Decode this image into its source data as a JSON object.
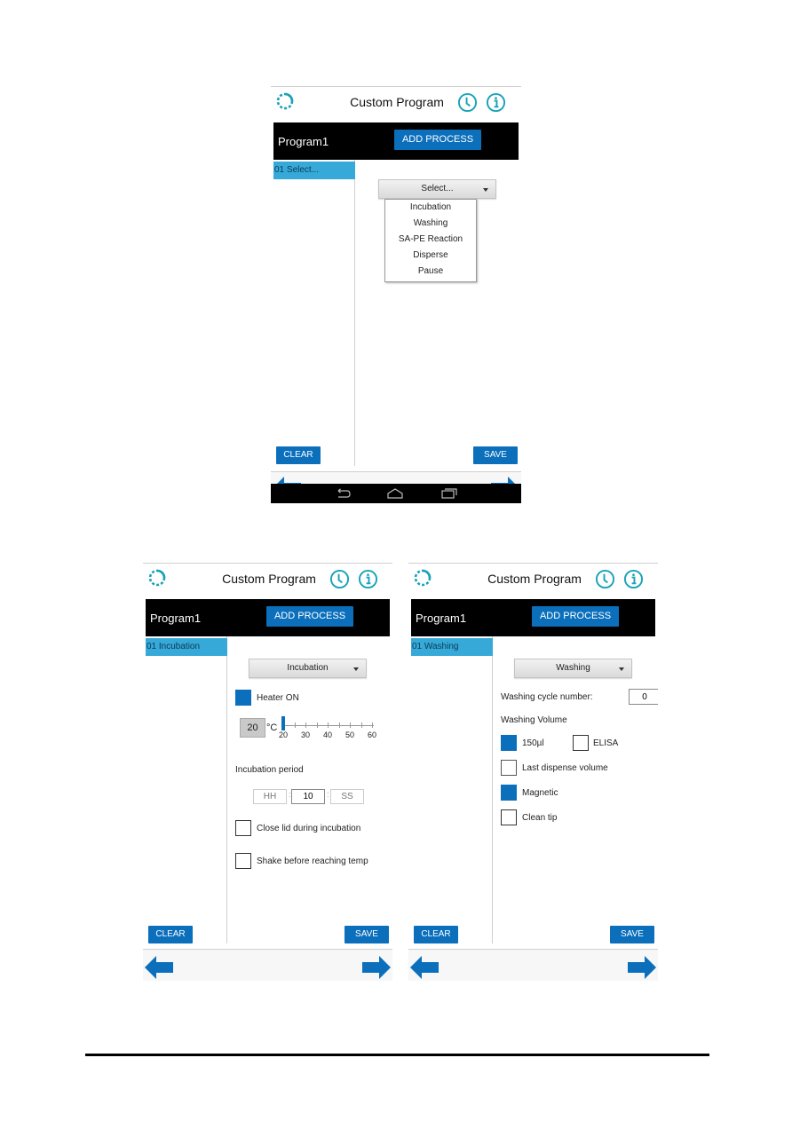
{
  "screens": [
    {
      "app_title": "Custom Program",
      "program_name": "Program1",
      "add_process_label": "ADD PROCESS",
      "step_label": "01 Select...",
      "process_select": {
        "selected": "Select...",
        "expanded": true,
        "options": [
          "Incubation",
          "Washing",
          "SA-PE Reaction",
          "Disperse",
          "Pause"
        ]
      },
      "clear_label": "CLEAR",
      "save_label": "SAVE",
      "system_nav": [
        "back-icon",
        "home-icon",
        "recent-apps-icon"
      ]
    },
    {
      "app_title": "Custom Program",
      "program_name": "Program1",
      "add_process_label": "ADD PROCESS",
      "step_label": "01 Incubation",
      "process_select": {
        "selected": "Incubation"
      },
      "heater": {
        "label": "Heater ON",
        "checked": true
      },
      "temperature": {
        "value": "20",
        "unit": "°C",
        "slider_min": 20,
        "slider_max": 60,
        "slider_value": 20,
        "ticks": [
          "20",
          "30",
          "40",
          "50",
          "60"
        ]
      },
      "incubation_period": {
        "label": "Incubation period",
        "hh_placeholder": "HH",
        "mm_value": "10",
        "ss_placeholder": "SS",
        "separator": ":"
      },
      "close_lid": {
        "label": "Close lid during incubation",
        "checked": false
      },
      "shake": {
        "label": "Shake before reaching temp",
        "checked": false
      },
      "clear_label": "CLEAR",
      "save_label": "SAVE"
    },
    {
      "app_title": "Custom Program",
      "program_name": "Program1",
      "add_process_label": "ADD PROCESS",
      "step_label": "01 Washing",
      "process_select": {
        "selected": "Washing"
      },
      "cycle_number": {
        "label": "Washing cycle number:",
        "value": "0"
      },
      "volume_label": "Washing Volume",
      "vol_150": {
        "label": "150µl",
        "checked": true
      },
      "elisa": {
        "label": "ELISA",
        "checked": false
      },
      "last_dispense": {
        "label": "Last dispense volume",
        "checked": false
      },
      "magnetic": {
        "label": "Magnetic",
        "checked": true
      },
      "clean_tip": {
        "label": "Clean tip",
        "checked": false
      },
      "clear_label": "CLEAR",
      "save_label": "SAVE"
    }
  ],
  "colors": {
    "accent": "#0b6fbc",
    "selected_step": "#36a9d8",
    "icon_teal": "#17a2b8",
    "program_bar": "#000000"
  }
}
